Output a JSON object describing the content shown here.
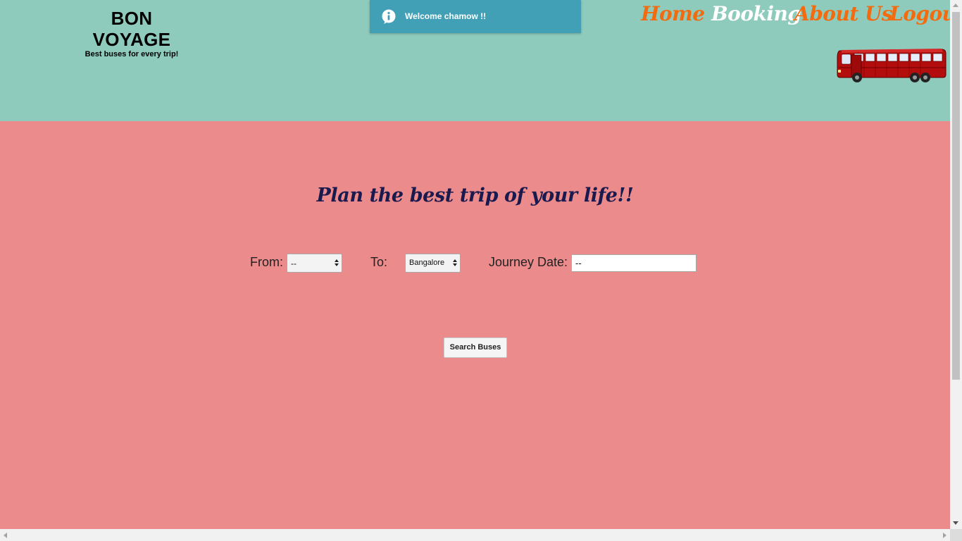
{
  "brand": {
    "title": "BON VOYAGE",
    "tagline": "Best buses for every trip!"
  },
  "toast": {
    "message": "Welcome chamow !!",
    "icon": "info-icon",
    "color": "#41a0b6"
  },
  "nav": {
    "items": [
      {
        "label": "Home",
        "active": false
      },
      {
        "label": "Booking",
        "active": true
      },
      {
        "label": "About Us",
        "active": false
      },
      {
        "label": "Logout",
        "active": false
      }
    ],
    "link_color": "#f26b0f",
    "active_color": "#ffffff"
  },
  "header": {
    "background": "#8fcbbd",
    "image": "red-bus-illustration"
  },
  "main": {
    "background": "#ec8b8b",
    "headline": "Plan the best trip of your life!!",
    "form": {
      "from_label": "From:",
      "from_value": "--",
      "to_label": "To:",
      "to_value": "Bangalore",
      "date_label": "Journey Date:",
      "date_value": "--"
    },
    "search_button": "Search Buses"
  }
}
